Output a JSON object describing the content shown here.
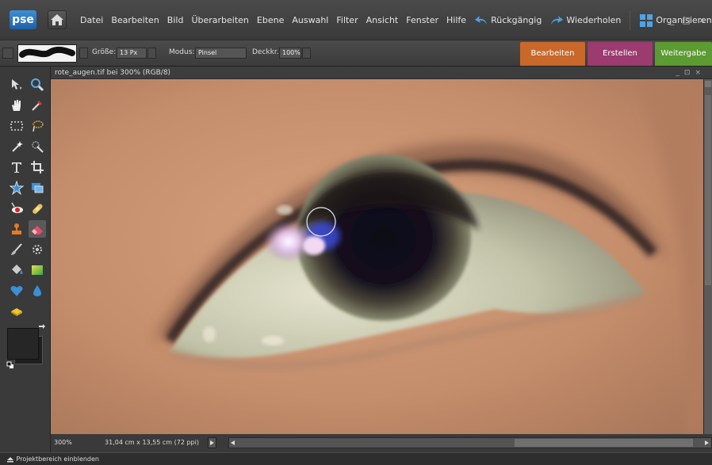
{
  "app": {
    "logo_text": "pse",
    "accent": "#3e8fd6"
  },
  "menubar": {
    "menus": [
      "Datei",
      "Bearbeiten",
      "Bild",
      "Überarbeiten",
      "Ebene",
      "Auswahl",
      "Filter",
      "Ansicht",
      "Fenster",
      "Hilfe"
    ],
    "undo_label": "Rückgängig",
    "redo_label": "Wiederholen",
    "organize_label": "Organisieren",
    "window_controls": [
      "_",
      "□",
      "×"
    ]
  },
  "options": {
    "size_label": "Größe:",
    "size_value": "13 Px",
    "mode_label": "Modus:",
    "mode_value": "Pinsel",
    "opacity_label": "Deckkr.:",
    "opacity_value": "100%"
  },
  "panel_tabs": [
    {
      "label": "Bearbeiten",
      "color": "#c8682a"
    },
    {
      "label": "Erstellen",
      "color": "#9c3b6f"
    },
    {
      "label": "Weitergabe",
      "color": "#5c9a32"
    }
  ],
  "document": {
    "title": "rote_augen.tif bei 300% (RGB/8)",
    "title_controls": [
      "_",
      "⊡",
      "×"
    ],
    "zoom": "300%",
    "dimensions": "31,04 cm x 13,55 cm (72 ppi)"
  },
  "toolbox": {
    "tools": [
      "move-tool",
      "zoom-tool",
      "hand-tool",
      "eyedropper-tool",
      "marquee-tool",
      "lasso-tool",
      "magic-wand-tool",
      "quick-selection-tool",
      "type-tool",
      "crop-tool",
      "shape-tool",
      "cookie-cutter-tool",
      "red-eye-tool",
      "healing-tool",
      "clone-stamp-tool",
      "eraser-tool",
      "brush-tool",
      "smart-brush-tool",
      "paint-bucket-tool",
      "gradient-tool",
      "custom-shape-tool",
      "blur-tool",
      "sponge-tool"
    ]
  },
  "bottombar": {
    "label": "Projektbereich einblenden"
  }
}
